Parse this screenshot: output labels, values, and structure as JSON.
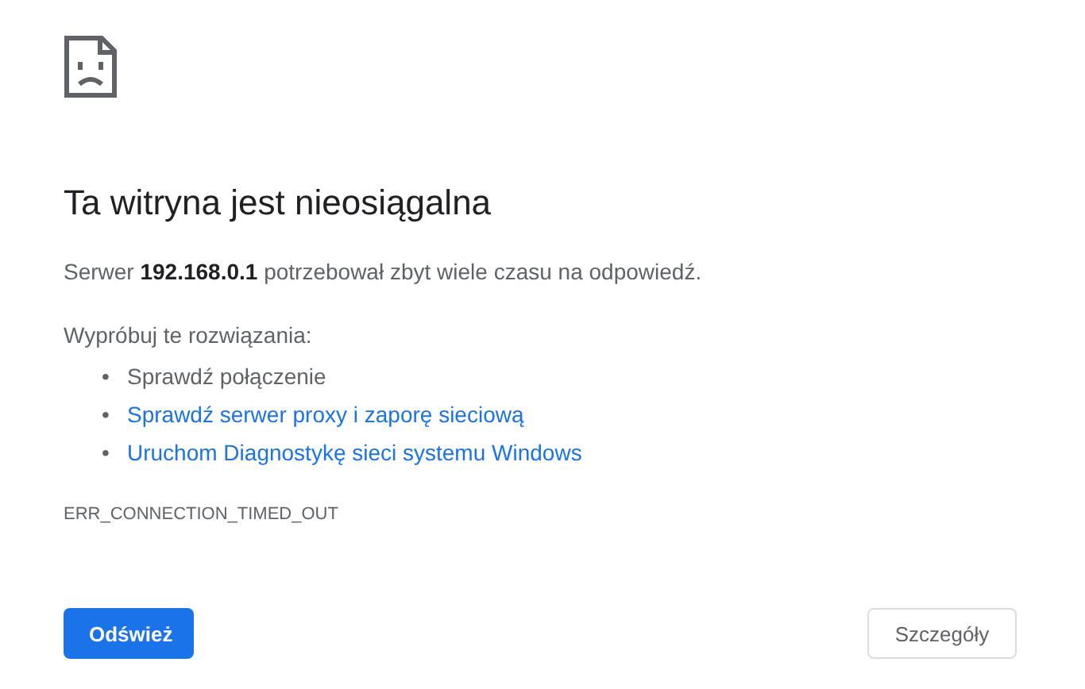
{
  "title": "Ta witryna jest nieosiągalna",
  "message": "Serwer **192.168.0.1** potrzebował zbyt wiele czasu na odpowiedź.",
  "suggestions_heading": "Wypróbuj te rozwiązania:",
  "suggestions": [
    {
      "kind": "text",
      "bullet": "•",
      "label": "Sprawdź połączenie"
    },
    {
      "kind": "link",
      "bullet": "•",
      "label": "Sprawdź serwer proxy i zaporę sieciową"
    },
    {
      "kind": "link",
      "bullet": "•",
      "label": "Uruchom Diagnostykę sieci systemu Windows"
    }
  ],
  "error_code": "ERR_CONNECTION_TIMED_OUT",
  "buttons": [
    {
      "kind": "primary",
      "label": "Odśwież"
    },
    {
      "kind": "secondary",
      "label": "Szczegóły"
    }
  ]
}
